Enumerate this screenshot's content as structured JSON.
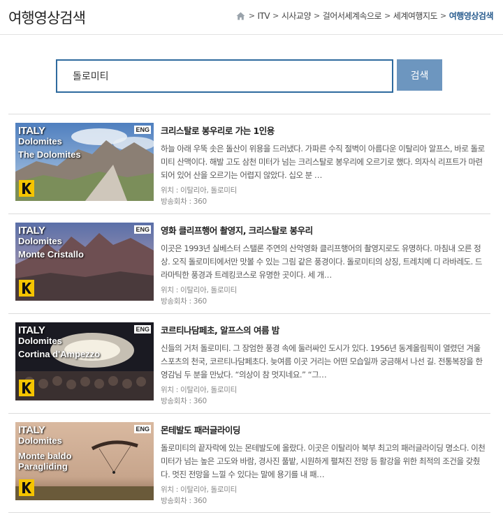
{
  "header": {
    "title": "여행영상검색",
    "breadcrumb": [
      "ITV",
      "시사교양",
      "걸어서세계속으로",
      "세계여행지도"
    ],
    "breadcrumb_current": "여행영상검색",
    "sep": ">"
  },
  "search": {
    "value": "돌로미티",
    "button_label": "검색"
  },
  "results": [
    {
      "thumb_line1": "ITALY",
      "thumb_line2": "Dolomites",
      "thumb_place": "The Dolomites",
      "badge": "ENG",
      "title": "크리스탈로 봉우리로 가는 1인용",
      "desc": "하늘 아래 우뚝 솟은 돌산이 위용을 드러냈다. 가파른 수직 절벽이 아름다운 이탈리아 알프스, 바로 돌로미티 산맥이다. 해발 고도 삼천 미터가 넘는 크리스탈로 봉우리에 오르기로 했다. 의자식 리프트가 마련되어 있어 산을 오르기는 어렵지 않았다. 십오 분 …",
      "location": "위치 : 이탈리아, 돌로미티",
      "episode": "방송회차 : 360"
    },
    {
      "thumb_line1": "ITALY",
      "thumb_line2": "Dolomites",
      "thumb_place": "Monte Cristallo",
      "badge": "ENG",
      "title": "영화 클리프행어 촬영지, 크리스탈로 봉우리",
      "desc": "이곳은 1993년 실베스터 스탤론 주연의 산악영화 클리프행어의 촬영지로도 유명하다. 마침내 오른 정상. 오직 돌로미티에서만 맛볼 수 있는 그림 같은 풍경이다. 돌로미티의 상징, 트레치메 디 라바레도. 드라마틱한 풍경과 트레킹코스로 유명한 곳이다. 세 개…",
      "location": "위치 : 이탈리아, 돌로미티",
      "episode": "방송회차 : 360"
    },
    {
      "thumb_line1": "ITALY",
      "thumb_line2": "Dolomites",
      "thumb_place": "Cortina d'Ampezzo",
      "badge": "ENG",
      "title": "코르티나담페초, 알프스의 여름 밤",
      "desc": "신들의 거처 돌로미티. 그 장엄한 풍경 속에 둘러싸인 도시가 있다. 1956년 동계올림픽이 열렸던 겨울 스포츠의 천국, 코르티나담페초다. 늦여름 이곳 거리는 어떤 모습일까 궁금해서 나선 길. 전통복장을 한 영감님 두 분을 만났다. “의상이 참 멋지네요.” “그…",
      "location": "위치 : 이탈리아, 돌로미티",
      "episode": "방송회차 : 360"
    },
    {
      "thumb_line1": "ITALY",
      "thumb_line2": "Dolomites",
      "thumb_place": "Monte baldo\nParagliding",
      "badge": "ENG",
      "title": "몬테발도 패러글라이딩",
      "desc": "돌로미티의 끝자락에 있는 몬테발도에 올랐다. 이곳은 이탈리아 북부 최고의 패러글라이딩 명소다. 이천 미터가 넘는 높은 고도와 바람, 경사진 풀밭, 시원하게 펼쳐진 전망 등 활강을 위한 최적의 조건을 갖췄다. 멋진 전망을 느낄 수 있다는 말에 용기를 내 패…",
      "location": "위치 : 이탈리아, 돌로미티",
      "episode": "방송회차 : 360"
    }
  ]
}
